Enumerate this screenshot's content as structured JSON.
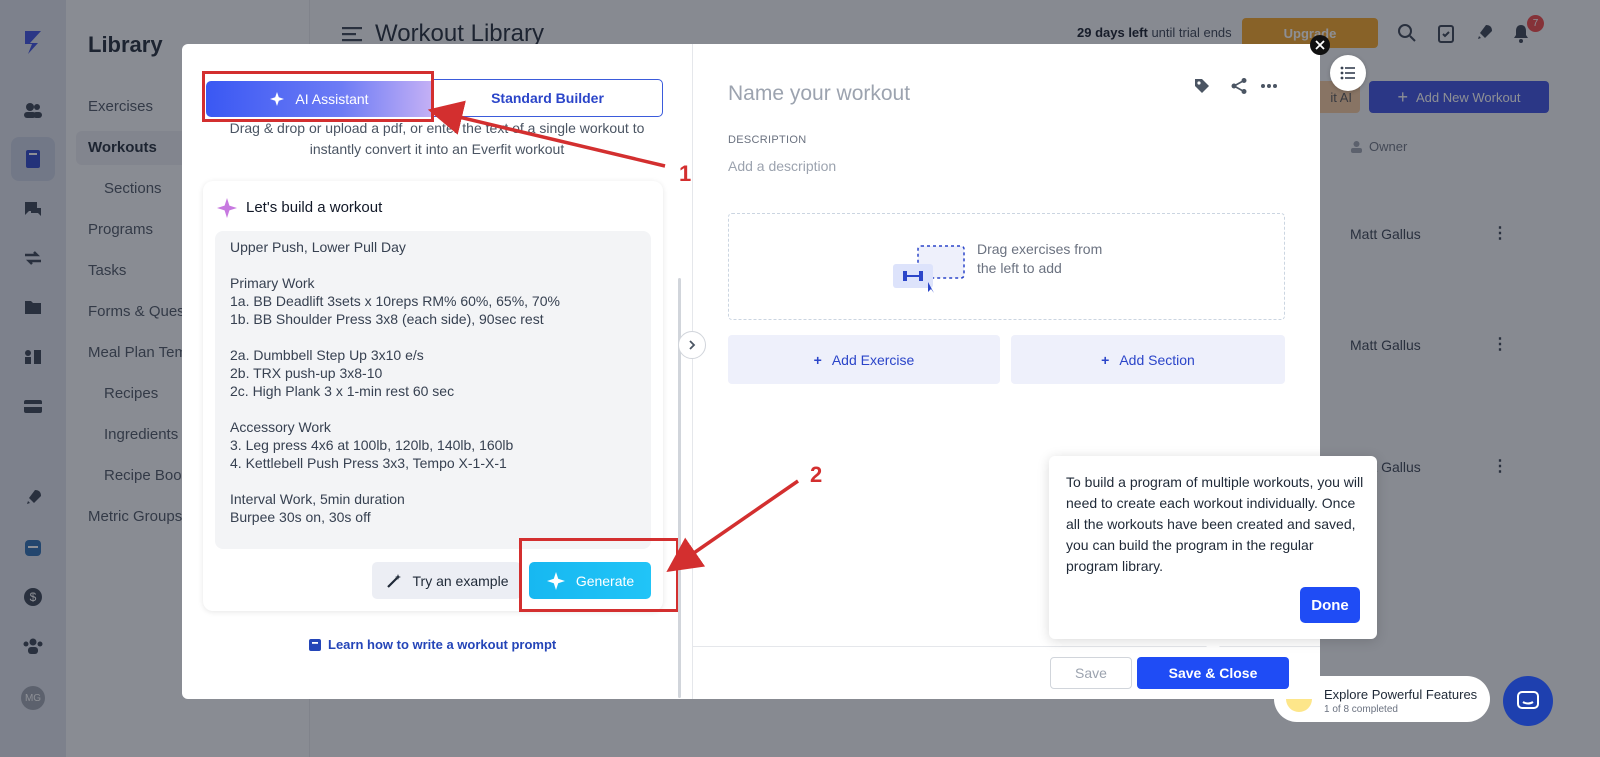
{
  "background": {
    "library": {
      "title": "Library",
      "items": [
        "Exercises",
        "Workouts",
        "Sections",
        "Programs",
        "Tasks",
        "Forms & Ques",
        "Meal Plan Tem",
        "Recipes",
        "Ingredients",
        "Recipe Boo",
        "Metric Groups"
      ]
    },
    "header": {
      "page_title": "Workout Library",
      "trial_days": "29 days left",
      "trial_suffix": "until trial ends",
      "upgrade_label": "Upgrade",
      "notification_count": "7"
    },
    "toolbar": {
      "edit_ai_label": "it AI",
      "add_new_label": "Add New Workout"
    },
    "table": {
      "owner_header": "Owner",
      "owners": [
        "Matt Gallus",
        "Matt Gallus",
        "Matt Gallus"
      ]
    },
    "avatar_initials": "MG",
    "explore": {
      "title": "Explore Powerful Features",
      "progress": "1 of 8 completed"
    }
  },
  "modal": {
    "tabs": {
      "ai": "AI Assistant",
      "standard": "Standard Builder"
    },
    "help_text": "Drag & drop or upload a pdf, or enter the text of a single workout to instantly convert it into an Everfit workout",
    "card": {
      "title": "Let's build a workout",
      "prompt_lines": [
        "Upper Push, Lower Pull Day",
        "",
        "Primary Work",
        "1a. BB Deadlift 3sets x 10reps RM% 60%, 65%, 70%",
        "1b. BB Shoulder Press 3x8 (each side), 90sec rest",
        "",
        "2a. Dumbbell Step Up 3x10 e/s",
        "2b. TRX push-up 3x8-10",
        "2c. High Plank 3 x 1-min rest 60 sec",
        "",
        "Accessory Work",
        "3. Leg press 4x6 at 100lb, 120lb, 140lb, 160lb",
        "4. Kettlebell Push Press 3x3, Tempo X-1-X-1",
        "",
        "Interval Work, 5min duration",
        "Burpee 30s on, 30s off"
      ],
      "try_example": "Try an example",
      "generate": "Generate"
    },
    "learn_link": "Learn how to write a workout prompt",
    "workout": {
      "name_placeholder": "Name your workout",
      "description_label": "DESCRIPTION",
      "description_placeholder": "Add a description",
      "dropzone_text_1": "Drag exercises from",
      "dropzone_text_2": "the left to add",
      "add_exercise": "Add Exercise",
      "add_section": "Add Section"
    },
    "footer": {
      "save": "Save",
      "save_close": "Save & Close"
    }
  },
  "tooltip": {
    "text": "To build a program of multiple workouts, you will need to create each workout individually. Once all the workouts have been created and saved, you can build the program in the regular program library.",
    "done": "Done"
  },
  "annotations": {
    "step1": "1",
    "step2": "2"
  },
  "colors": {
    "primary": "#1f4cf5",
    "accent_red": "#d32f2f",
    "generate": "#17b8f1",
    "upgrade": "#f5a524"
  }
}
